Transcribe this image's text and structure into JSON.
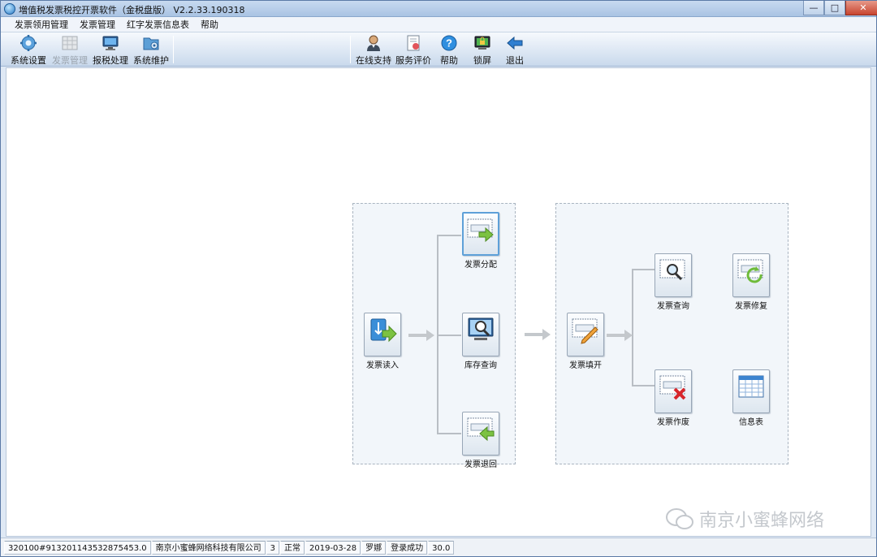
{
  "window": {
    "title": "増值税发票税控开票软件（金税盘版） V2.2.33.190318"
  },
  "menu": [
    "发票领用管理",
    "发票管理",
    "红字发票信息表",
    "帮助"
  ],
  "toolbar_left": [
    {
      "label": "系统设置",
      "icon": "gear-icon",
      "disabled": false
    },
    {
      "label": "发票管理",
      "icon": "invoice-grid-icon",
      "disabled": true
    },
    {
      "label": "报税处理",
      "icon": "monitor-icon",
      "disabled": false
    },
    {
      "label": "系统维护",
      "icon": "folder-gear-icon",
      "disabled": false
    }
  ],
  "toolbar_right": [
    {
      "label": "在线支持",
      "icon": "person-icon"
    },
    {
      "label": "服务评价",
      "icon": "rating-doc-icon"
    },
    {
      "label": "帮助",
      "icon": "help-icon"
    },
    {
      "label": "锁屏",
      "icon": "lock-screen-icon"
    },
    {
      "label": "退出",
      "icon": "exit-arrow-icon"
    }
  ],
  "flow_left": {
    "read": "发票读入",
    "distribute": "发票分配",
    "stock_query": "库存查询",
    "return": "发票退回"
  },
  "flow_right": {
    "fill": "发票填开",
    "query": "发票查询",
    "repair": "发票修复",
    "void": "发票作废",
    "info_table": "信息表"
  },
  "watermark": "南京小蜜蜂网络",
  "status": [
    "320100#913201143532875453.0",
    "南京小蜜蜂网络科技有限公司",
    "3",
    "正常",
    "2019-03-28",
    "罗娜",
    "登录成功",
    "30.0"
  ],
  "colors": {
    "accent": "#5ea0d8",
    "titlebar": "#a9c3e3",
    "close": "#c8452f"
  }
}
